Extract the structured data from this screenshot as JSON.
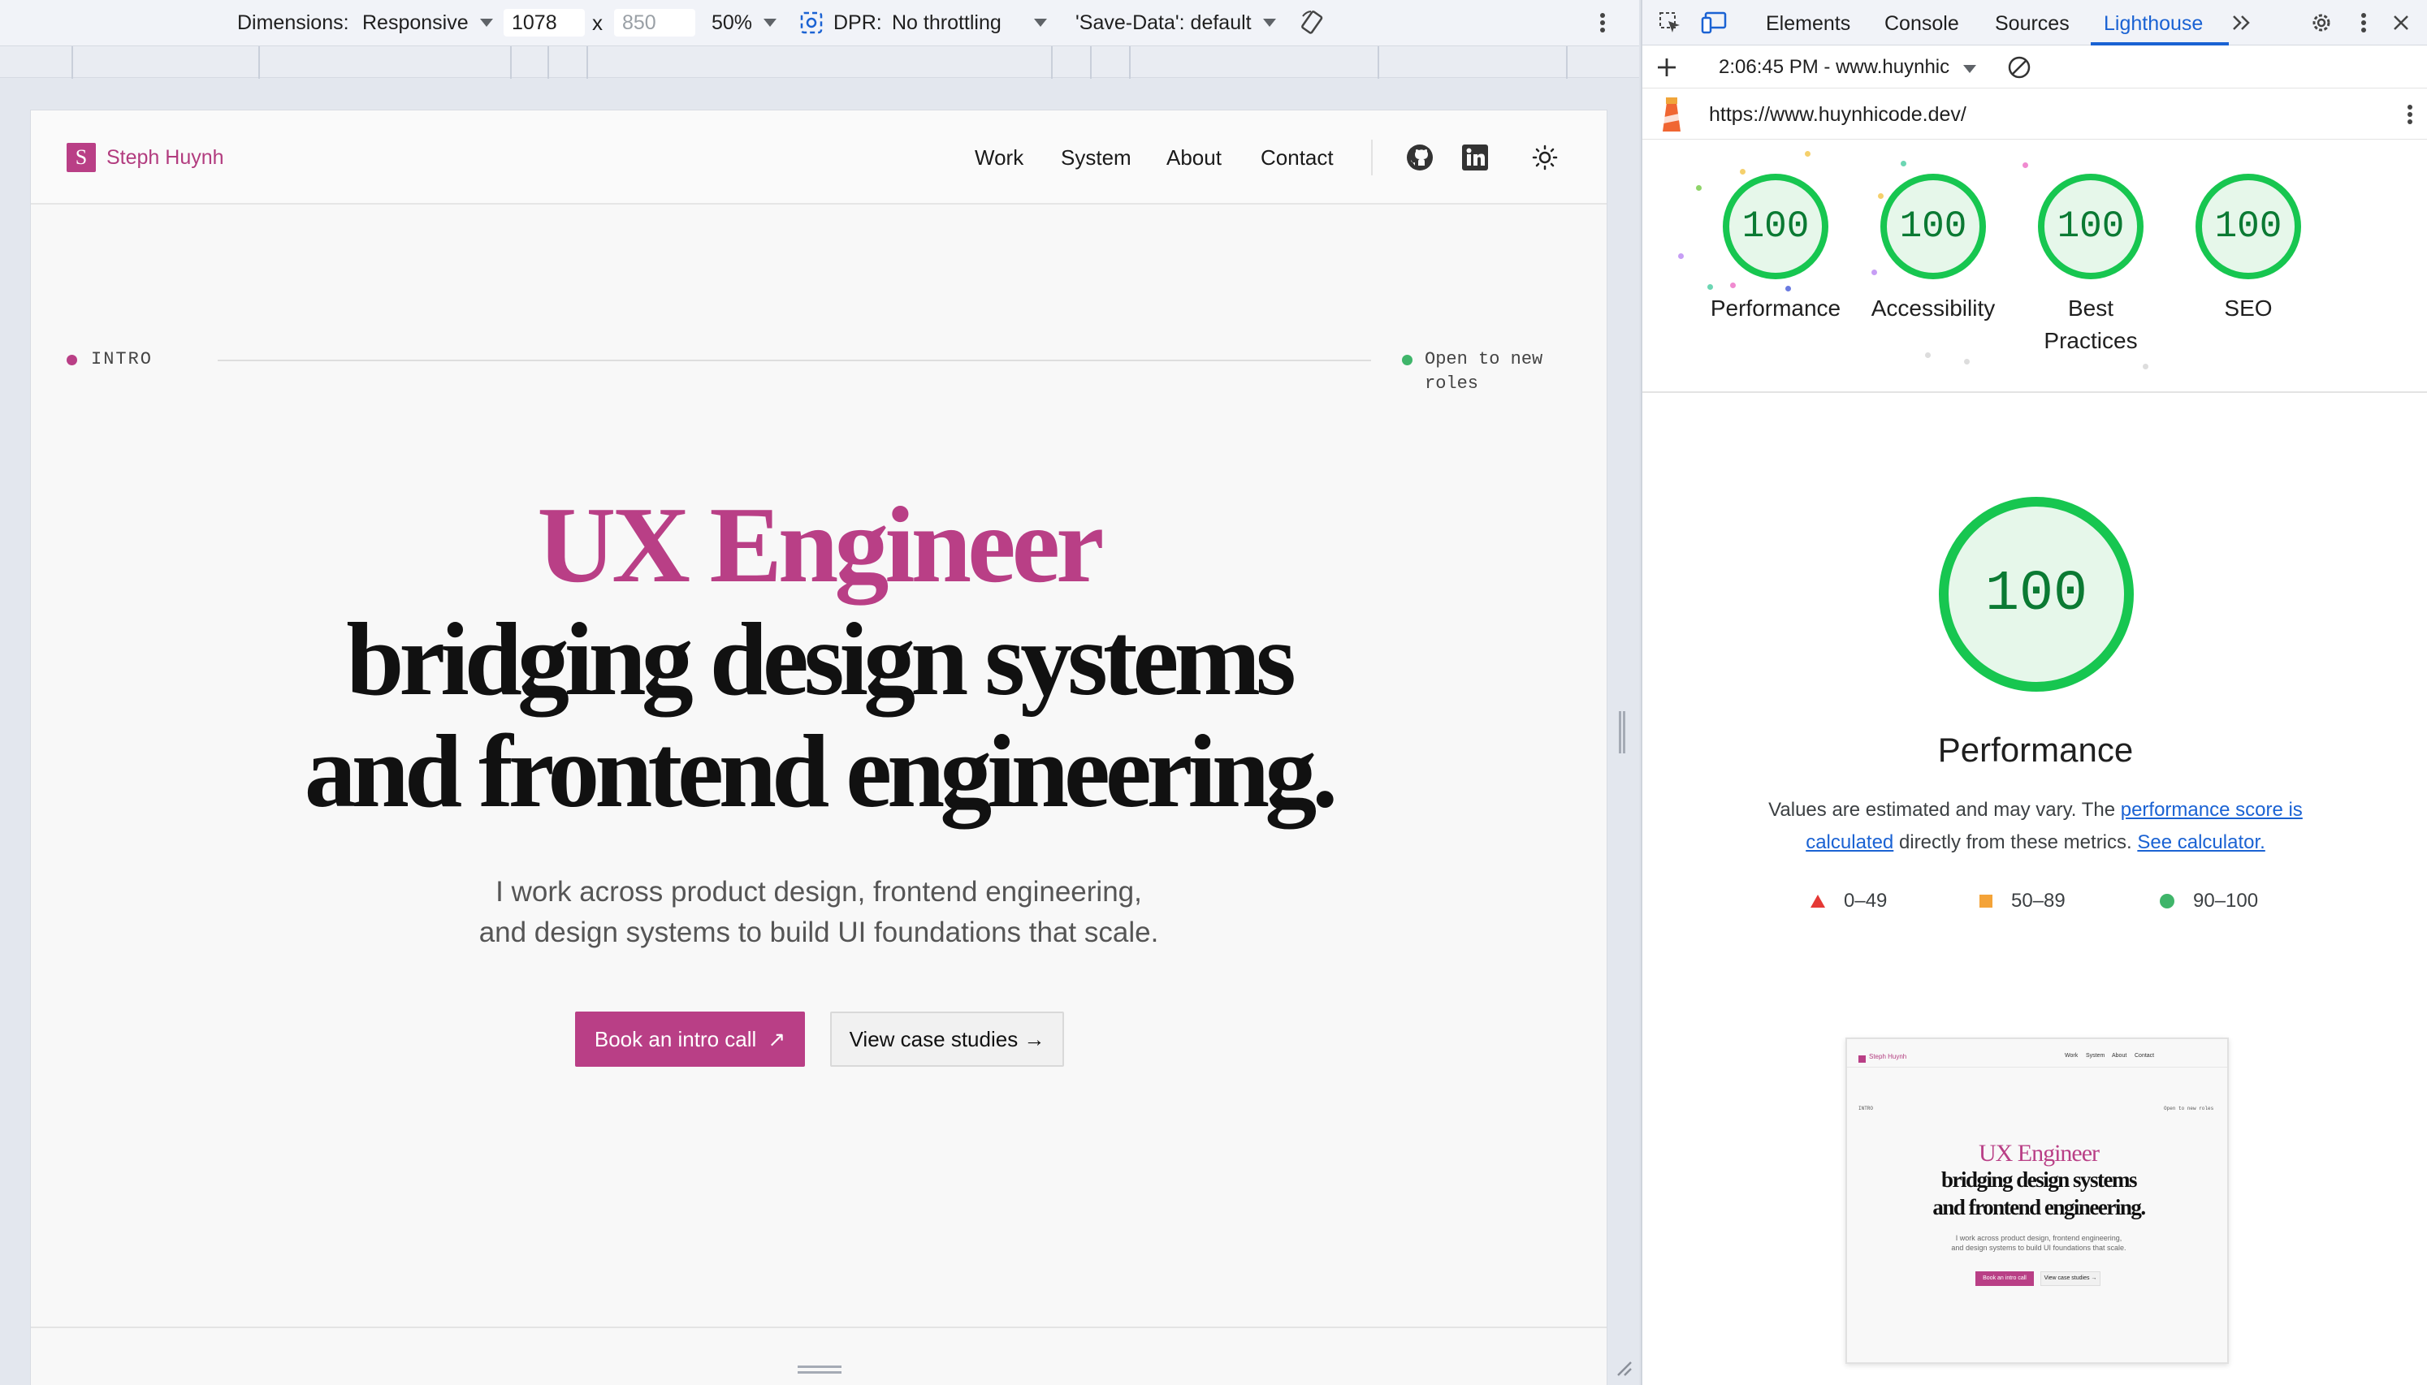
{
  "device_toolbar": {
    "dimensions_label": "Dimensions:",
    "dimensions_value": "Responsive",
    "width": "1078",
    "times": "x",
    "height_placeholder": "850",
    "zoom": "50%",
    "dpr_label": "DPR:",
    "throttling": "No throttling",
    "save_data": "'Save-Data': default"
  },
  "site": {
    "logo_letter": "S",
    "logo_text": "Steph Huynh",
    "nav": [
      "Work",
      "System",
      "About",
      "Contact"
    ],
    "intro_label": "INTRO",
    "status": "Open to new roles",
    "hero_accent": "UX Engineer",
    "hero_line1": "bridging design systems",
    "hero_line2": "and frontend engineering.",
    "sub_line1": "I work across product design, frontend engineering,",
    "sub_line2": "and design systems to build UI foundations that scale.",
    "cta_primary": "Book an intro call",
    "cta_primary_icon": "↗",
    "cta_secondary": "View case studies →"
  },
  "devtools": {
    "tabs": [
      "Elements",
      "Console",
      "Sources",
      "Lighthouse"
    ],
    "active_tab": "Lighthouse",
    "report_select": "2:06:45 PM - www.huynhic",
    "url": "https://www.huynhicode.dev/",
    "gauges": [
      {
        "score": "100",
        "label": "Performance"
      },
      {
        "score": "100",
        "label": "Accessibility"
      },
      {
        "score": "100",
        "label": "Best Practices"
      },
      {
        "score": "100",
        "label": "SEO"
      }
    ],
    "perf_score": "100",
    "perf_title": "Performance",
    "perf_desc_1": "Values are estimated and may vary. The ",
    "perf_desc_link1": "performance score is calculated",
    "perf_desc_2": " directly from these metrics. ",
    "perf_desc_link2": "See calculator.",
    "legend": [
      "0–49",
      "50–89",
      "90–100"
    ],
    "colors": {
      "fail": "#e53935",
      "average": "#f4a338",
      "pass": "#3fb56a",
      "accent": "#b93f86"
    }
  },
  "thumbnail": {
    "logo_text": "Steph Huynh",
    "nav": [
      "Work",
      "System",
      "About",
      "Contact"
    ],
    "intro_label": "INTRO",
    "status": "Open to new roles",
    "hero_accent": "UX Engineer",
    "hero_line1": "bridging design systems",
    "hero_line2": "and frontend engineering.",
    "sub_line1": "I work across product design, frontend engineering,",
    "sub_line2": "and design systems to build UI foundations that scale.",
    "cta_primary": "Book an intro call",
    "cta_secondary": "View case studies →"
  }
}
